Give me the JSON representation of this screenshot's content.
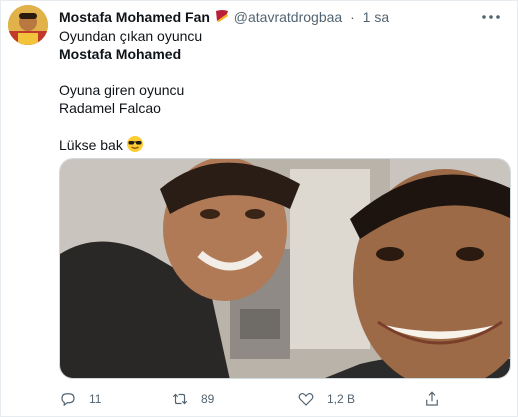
{
  "tweet": {
    "display_name": "Mostafa Mohamed Fan",
    "handle": "@atavratdrogbaa",
    "separator": "·",
    "time": "1 sa",
    "lines": {
      "line1": "Oyundan çıkan oyuncu",
      "line2": "Mostafa Mohamed",
      "line3": "Oyuna giren oyuncu",
      "line4": "Radamel Falcao",
      "line5": "Lükse bak"
    },
    "emoji": "sunglasses-emoji",
    "badge_icon": "galatasaray-badge-icon",
    "media_description": "selfie-photo",
    "actions": {
      "reply_count": "11",
      "retweet_count": "89",
      "like_count": "1,2 B"
    }
  },
  "colors": {
    "text_primary": "#0f1419",
    "text_secondary": "#536471",
    "border": "#cfd9de",
    "badge_red": "#b8203a",
    "badge_gold": "#f6b21a"
  }
}
